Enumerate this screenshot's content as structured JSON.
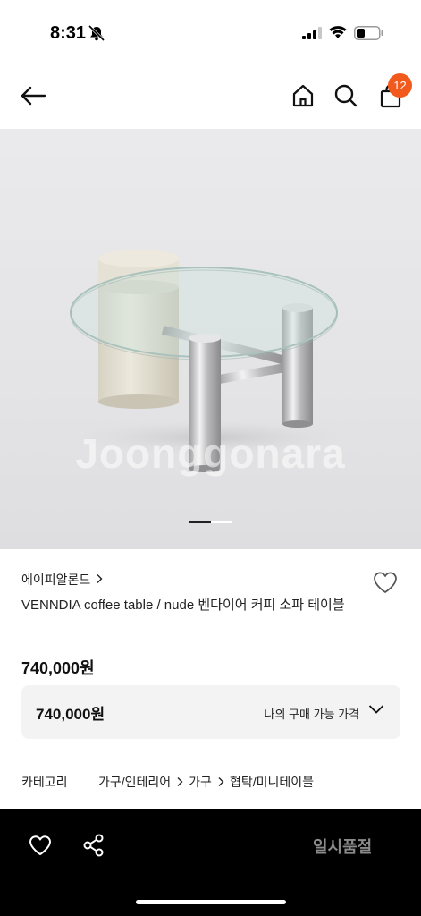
{
  "status_bar": {
    "time": "8:31"
  },
  "nav": {
    "cart_count": "12"
  },
  "image": {
    "watermark": "Joonggonara"
  },
  "product": {
    "seller": "에이피알론드",
    "title": "VENNDIA coffee table / nude 벤다이어 커피 소파 테이블",
    "price": "740,000원"
  },
  "price_box": {
    "price": "740,000원",
    "label": "나의 구매 가능 가격"
  },
  "category": {
    "label": "카테고리",
    "path": [
      "가구/인테리어",
      "가구",
      "협탁/미니테이블"
    ]
  },
  "bottom_bar": {
    "status_label": "일시품절"
  },
  "colors": {
    "badge": "#f15a1c",
    "bottom_bar": "#000000"
  }
}
